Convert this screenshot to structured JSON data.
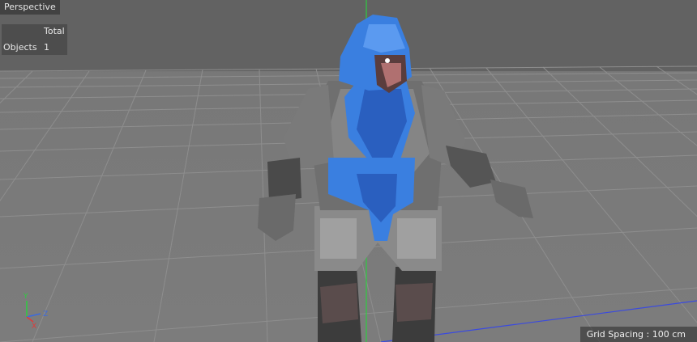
{
  "viewport": {
    "camera_label": "Perspective",
    "grid_spacing": "Grid Spacing : 100 cm",
    "colors": {
      "background": "#7a7a7a",
      "axis_y": "#2ecc40",
      "axis_x": "#e03a3a",
      "axis_z": "#3a6ae0",
      "armor_blue": "#3a7fe0"
    }
  },
  "stats": {
    "header_total": "Total",
    "rows": [
      {
        "label": "Objects",
        "value": "1"
      }
    ]
  },
  "axes_gizmo": {
    "y": "Y",
    "z": "Z",
    "x": "X"
  },
  "model": {
    "icon": "alien-warrior-model"
  }
}
